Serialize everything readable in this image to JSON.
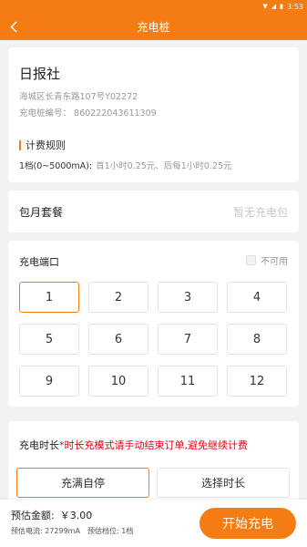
{
  "status_bar": {
    "time": "3:53"
  },
  "app_bar": {
    "title": "充电桩"
  },
  "station": {
    "name": "日报社",
    "address": "海城区长青东路107号Y02272",
    "code": "充电桩编号： 860222043611309",
    "rules_title": "计费规则",
    "rule_level": "1档(0~5000mA):",
    "rule_desc": "首1小时0.25元、后每1小时0.25元"
  },
  "monthly": {
    "label": "包月套餐",
    "value": "暂无充电包"
  },
  "ports": {
    "header": "充电端口",
    "legend": "不可用",
    "items": [
      "1",
      "2",
      "3",
      "4",
      "5",
      "6",
      "7",
      "8",
      "9",
      "10",
      "11",
      "12"
    ],
    "selected": "1"
  },
  "duration": {
    "label": "充电时长",
    "warning": "*时长充模式请手动结束订单,避免继续计费",
    "option_full": "充满自停",
    "option_choose": "选择时长"
  },
  "bottom": {
    "estimate_label": "预估金额:",
    "estimate_value": "￥3.00",
    "current": "预估电流: 27299mA",
    "gear": "预估档位: 1档",
    "start": "开始充电"
  },
  "colors": {
    "accent": "#f57c12",
    "warning": "#e60012"
  }
}
